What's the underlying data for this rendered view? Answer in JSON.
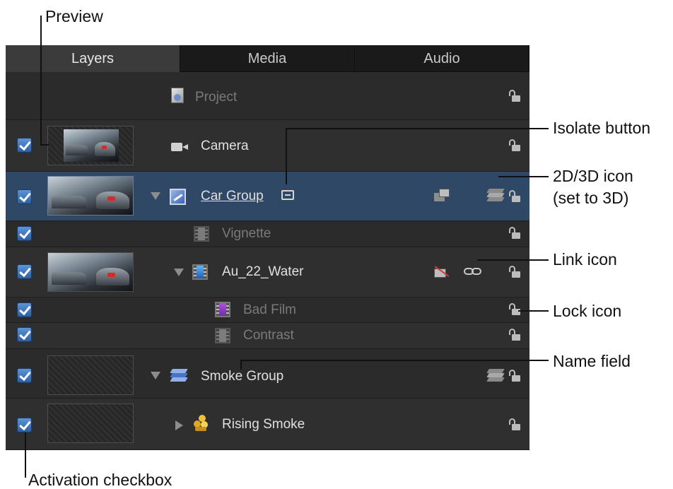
{
  "tabs": [
    {
      "label": "Layers",
      "active": true
    },
    {
      "label": "Media",
      "active": false
    },
    {
      "label": "Audio",
      "active": false
    }
  ],
  "rows": {
    "project": {
      "name": "Project"
    },
    "camera": {
      "name": "Camera",
      "active": true
    },
    "car_group": {
      "name": "Car Group",
      "active": true,
      "selected": true
    },
    "vignette": {
      "name": "Vignette",
      "active": true
    },
    "au_water": {
      "name": "Au_22_Water",
      "active": true
    },
    "bad_film": {
      "name": "Bad Film",
      "active": true
    },
    "contrast": {
      "name": "Contrast",
      "active": true
    },
    "smoke_group": {
      "name": "Smoke Group",
      "active": true
    },
    "rising_smoke": {
      "name": "Rising Smoke",
      "active": true
    }
  },
  "callouts": {
    "preview": "Preview",
    "isolate": "Isolate button",
    "icon_2d3d_line1": "2D/3D icon",
    "icon_2d3d_line2": "(set to 3D)",
    "link": "Link icon",
    "lock": "Lock icon",
    "name_field": "Name field",
    "activation": "Activation checkbox"
  },
  "colors": {
    "panel_bg": "#2a2a2a",
    "selected_row": "#2f4866",
    "checkbox": "#3f7ac4"
  }
}
